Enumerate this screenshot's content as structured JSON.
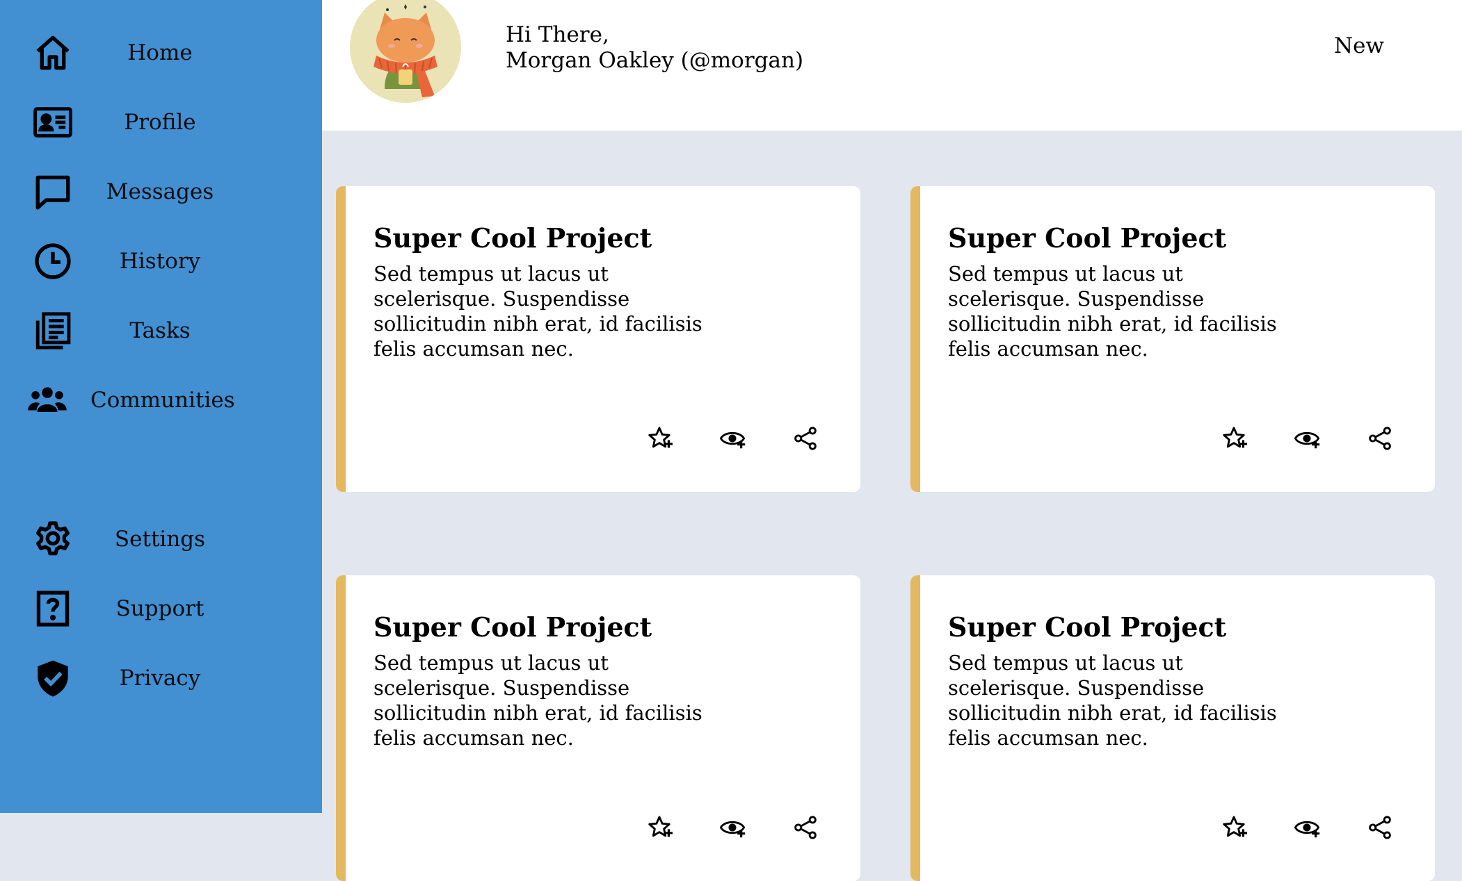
{
  "sidebar": {
    "top_items": [
      {
        "label": "Home",
        "icon": "home-icon"
      },
      {
        "label": "Profile",
        "icon": "id-card-icon"
      },
      {
        "label": "Messages",
        "icon": "chat-bubble-icon"
      },
      {
        "label": "History",
        "icon": "clock-icon"
      },
      {
        "label": "Tasks",
        "icon": "document-list-icon"
      },
      {
        "label": "Communities",
        "icon": "group-icon"
      }
    ],
    "bottom_items": [
      {
        "label": "Settings",
        "icon": "gear-icon"
      },
      {
        "label": "Support",
        "icon": "question-icon"
      },
      {
        "label": "Privacy",
        "icon": "shield-check-icon"
      }
    ]
  },
  "header": {
    "greeting_line1": "Hi There,",
    "greeting_line2": "Morgan Oakley (@morgan)",
    "new_label": "New"
  },
  "cards": [
    {
      "title": "Super Cool Project",
      "description": "Sed tempus ut lacus ut scelerisque. Suspendisse sollicitudin nibh erat, id facilisis felis accumsan nec."
    },
    {
      "title": "Super Cool Project",
      "description": "Sed tempus ut lacus ut scelerisque. Suspendisse sollicitudin nibh erat, id facilisis felis accumsan nec."
    },
    {
      "title": "Super Cool Project",
      "description": "Sed tempus ut lacus ut scelerisque. Suspendisse sollicitudin nibh erat, id facilisis felis accumsan nec."
    },
    {
      "title": "Super Cool Project",
      "description": "Sed tempus ut lacus ut scelerisque. Suspendisse sollicitudin nibh erat, id facilisis felis accumsan nec."
    }
  ],
  "card_actions": [
    "star-plus-icon",
    "eye-plus-icon",
    "share-icon"
  ],
  "colors": {
    "sidebar": "#428fd2",
    "background": "#e2e6ee",
    "card_accent": "#e2b960",
    "avatar_bg": "#e9e3b6"
  }
}
